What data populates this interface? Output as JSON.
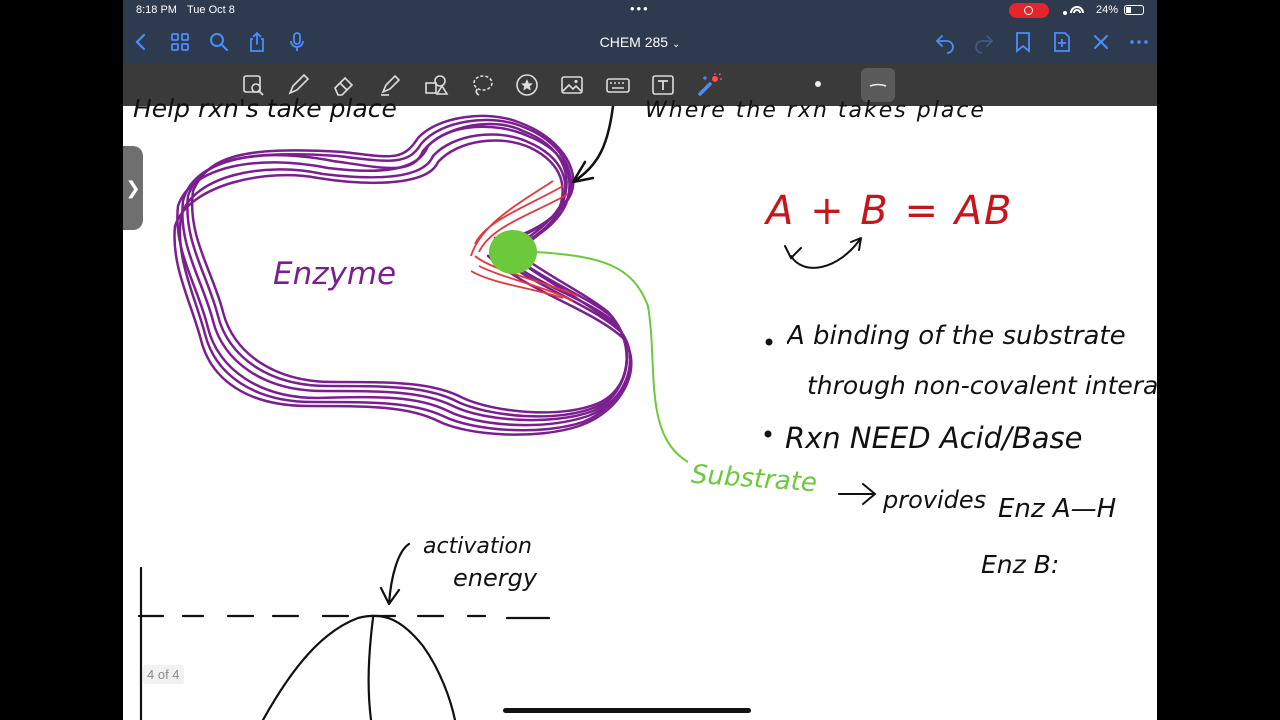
{
  "status": {
    "time": "8:18 PM",
    "date": "Tue Oct 8",
    "battery": "24%",
    "record_indicator": "record-icon"
  },
  "nav": {
    "title": "CHEM 285",
    "title_chevron": "⌄",
    "icons_left": [
      "back-icon",
      "grid-icon",
      "search-icon",
      "share-icon",
      "mic-icon"
    ],
    "icons_right": [
      "undo-icon",
      "redo-icon",
      "bookmark-icon",
      "add-page-icon",
      "close-icon",
      "more-icon"
    ]
  },
  "toolbar": {
    "tools": [
      "lasso-zoom-icon",
      "pen-icon",
      "eraser-icon",
      "highlighter-icon",
      "shapes-icon",
      "lasso-icon",
      "sticker-icon",
      "image-icon",
      "keyboard-icon",
      "textbox-icon",
      "laser-icon"
    ],
    "accent": "#4a8cff"
  },
  "notes": {
    "line1": "Help rxn's take place",
    "line2": "Where the rxn takes place",
    "enzyme_label": "Enzyme",
    "equation": "A + B = AB",
    "bullet1_a": "A binding of the substrate",
    "bullet1_b": "through non-covalent interact",
    "bullet2": "Rxn NEED Acid/Base",
    "provides": "provides",
    "enz_ah": "Enz A—H",
    "enz_b": "Enz B:",
    "substrate": "Substrate",
    "activation_1": "activation",
    "activation_2": "energy",
    "colors": {
      "enzyme": "#7a1f8e",
      "red": "#c4161c",
      "green": "#6cc93c",
      "ink": "#111111"
    }
  },
  "page": {
    "indicator": "4 of 4",
    "side_handle": "❯"
  }
}
